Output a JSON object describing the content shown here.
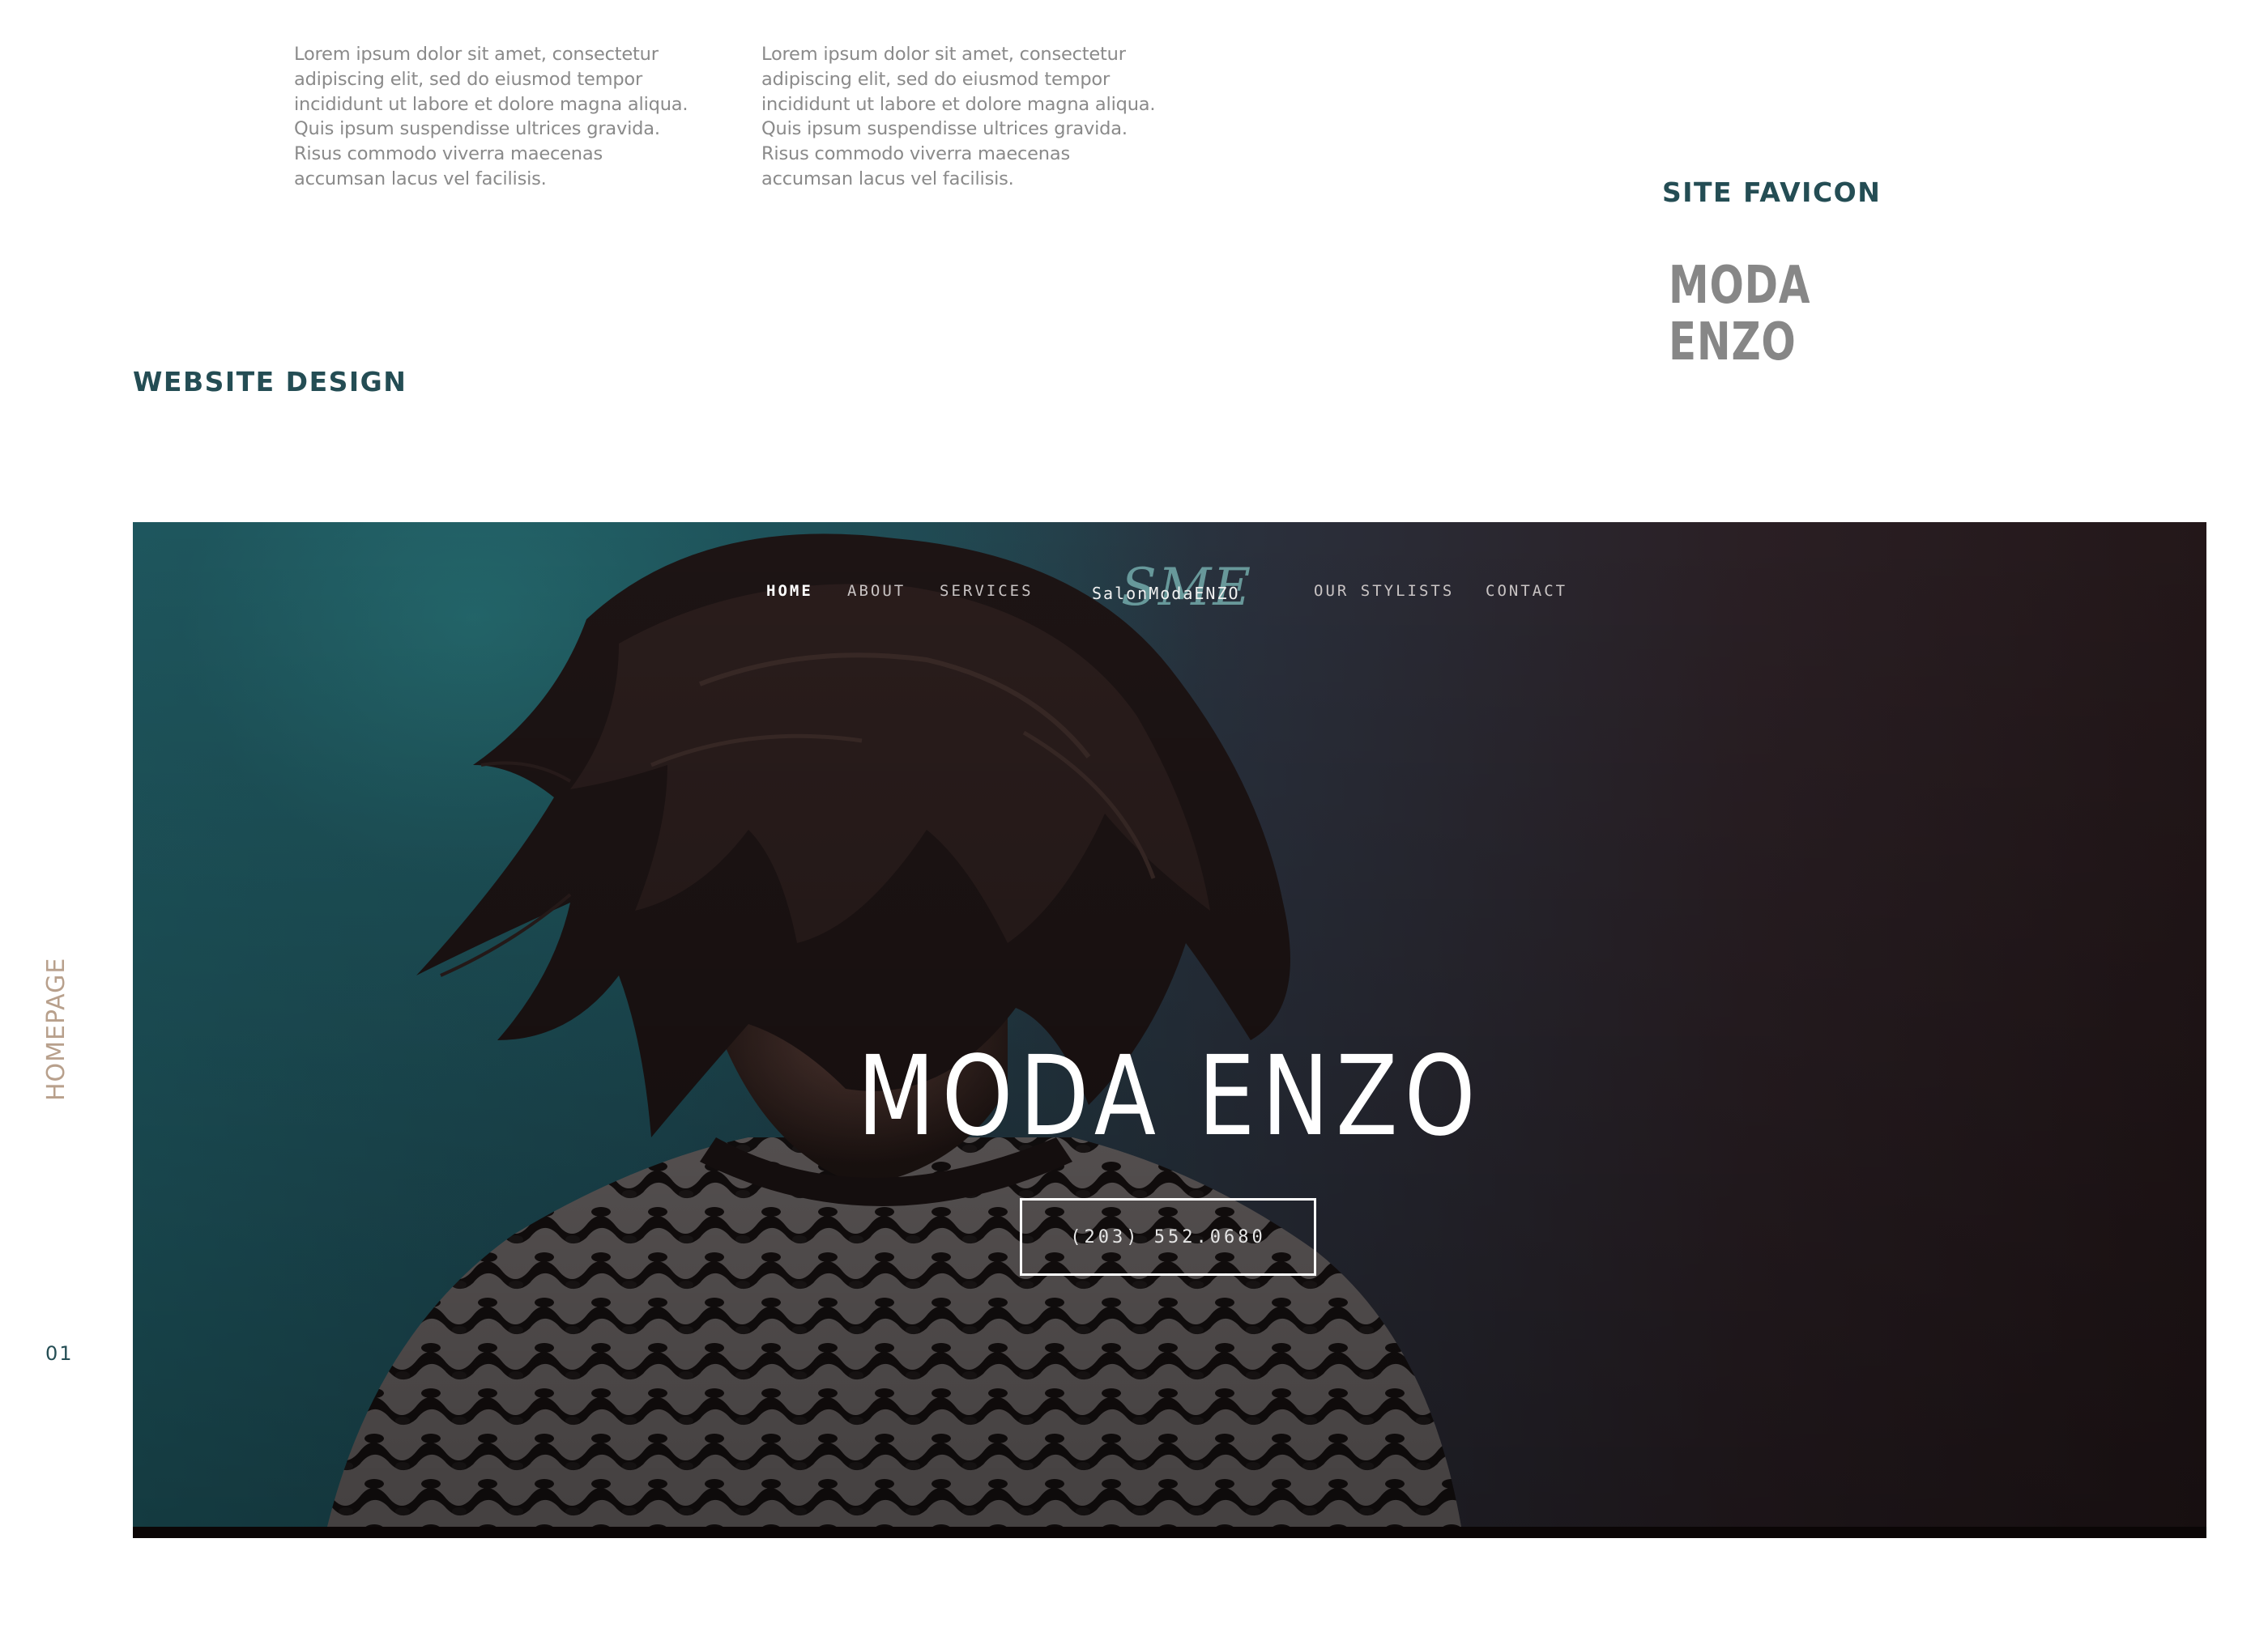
{
  "intro_text": {
    "column1": [
      "Lorem ipsum dolor sit amet, consectetur",
      "adipiscing elit, sed do eiusmod tempor",
      "incididunt ut labore et dolore magna aliqua.",
      "Quis ipsum suspendisse ultrices gravida.",
      "Risus commodo viverra maecenas",
      "accumsan lacus vel facilisis."
    ],
    "column2": [
      "Lorem ipsum dolor sit amet, consectetur",
      "adipiscing elit, sed do eiusmod tempor",
      "incididunt ut labore et dolore magna aliqua.",
      "Quis ipsum suspendisse ultrices gravida.",
      "Risus commodo viverra maecenas",
      "accumsan lacus vel facilisis."
    ]
  },
  "favicon": {
    "title": "SITE FAVICON",
    "logo_lines": [
      "MODA",
      "ENZO"
    ]
  },
  "website": {
    "title": "WEBSITE DESIGN",
    "side_label": "HOMEPAGE",
    "page_number": "01"
  },
  "hero": {
    "nav": {
      "home": "HOME",
      "about": "ABOUT",
      "services": "SERVICES",
      "logo_mark": "SME",
      "logo_text": "SalonModaENZO",
      "stylists": "OUR STYLISTS",
      "contact": "CONTACT"
    },
    "title": "MODA ENZO",
    "phone": "(203) 552.0680"
  },
  "colors": {
    "heading": "#244d54",
    "body_text": "#8a8a8a",
    "side_label": "#b8a08c",
    "favicon_logo": "#878787"
  }
}
